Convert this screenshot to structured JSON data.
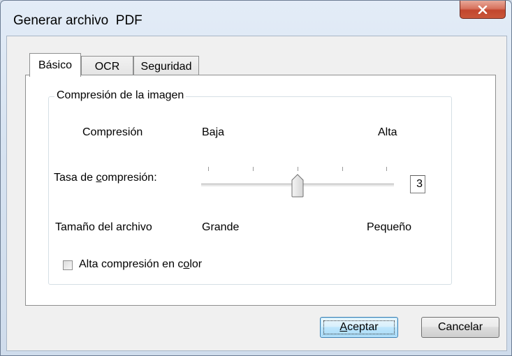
{
  "window": {
    "title": "Generar archivo  PDF"
  },
  "tabs": [
    {
      "label": "Básico",
      "active": true
    },
    {
      "label": "OCR",
      "active": false
    },
    {
      "label": "Seguridad",
      "active": false
    }
  ],
  "group": {
    "legend": "Compresión de la imagen",
    "compression_label": "Compresión",
    "low_label": "Baja",
    "high_label": "Alta",
    "rate_label_pre": "Tasa de ",
    "rate_label_mnemonic": "c",
    "rate_label_post": "ompresión:",
    "slider": {
      "value": 3,
      "min": 1,
      "max": 5,
      "ticks": 5
    },
    "rate_value": "3",
    "filesize_label": "Tamaño del archivo",
    "large_label": "Grande",
    "small_label": "Pequeño",
    "checkbox": {
      "label_pre": "Alta compresión en c",
      "label_mnemonic": "o",
      "label_post": "lor",
      "checked": false
    }
  },
  "buttons": {
    "accept_mnemonic": "A",
    "accept_rest": "ceptar",
    "cancel": "Cancelar"
  },
  "colors": {
    "close_button": "#c9563a",
    "default_button_border": "#3c7fb1",
    "window_frame": "#d7e3f1"
  }
}
